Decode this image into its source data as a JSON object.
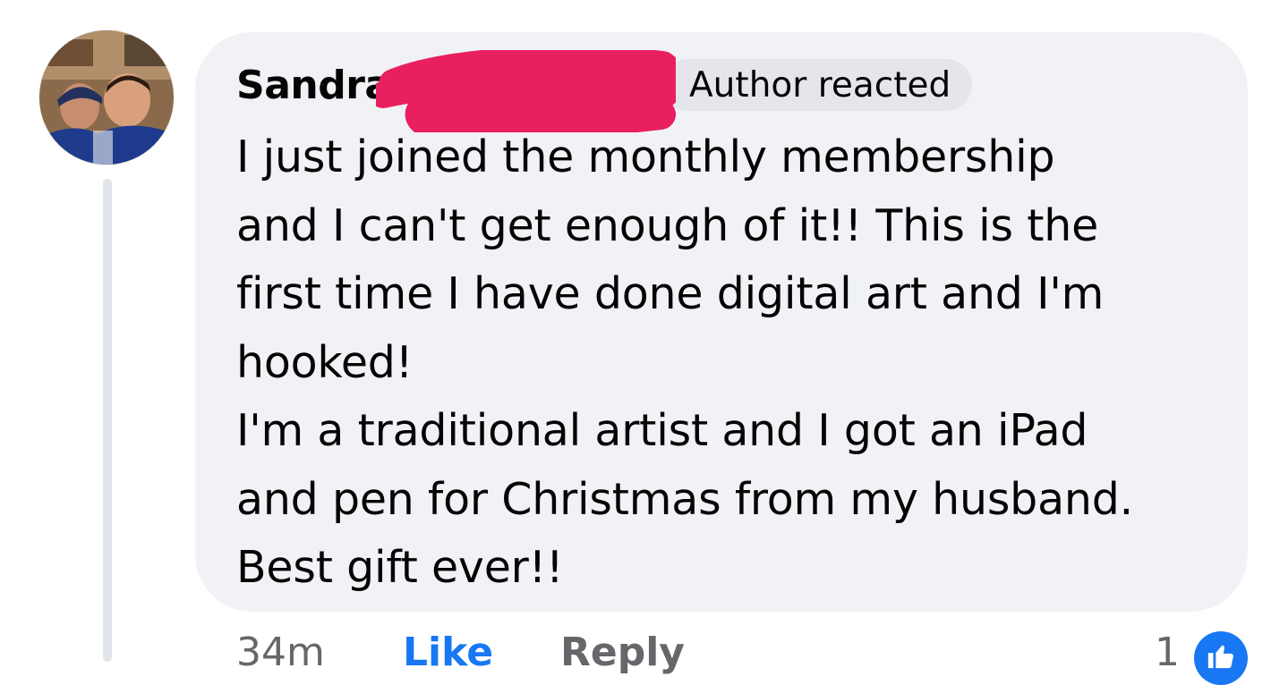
{
  "comment": {
    "author": "Sandra",
    "badge": "Author reacted",
    "lines": [
      "I just joined the monthly membership",
      "and I can't get enough of it!! This is the",
      "first time I have done digital art and I'm",
      "hooked!",
      "I'm a traditional artist and I got an iPad",
      "and pen for Christmas from my husband.",
      "Best gift ever!!"
    ]
  },
  "actions": {
    "time": "34m",
    "like_label": "Like",
    "reply_label": "Reply",
    "reaction_count": "1"
  },
  "icons": {
    "avatar": "profile-photo",
    "reaction": "thumbs-up-icon"
  },
  "colors": {
    "bubble": "#f0f2f5",
    "badge": "#e4e6eb",
    "redaction": "#e8205f",
    "like": "#1877f2"
  }
}
